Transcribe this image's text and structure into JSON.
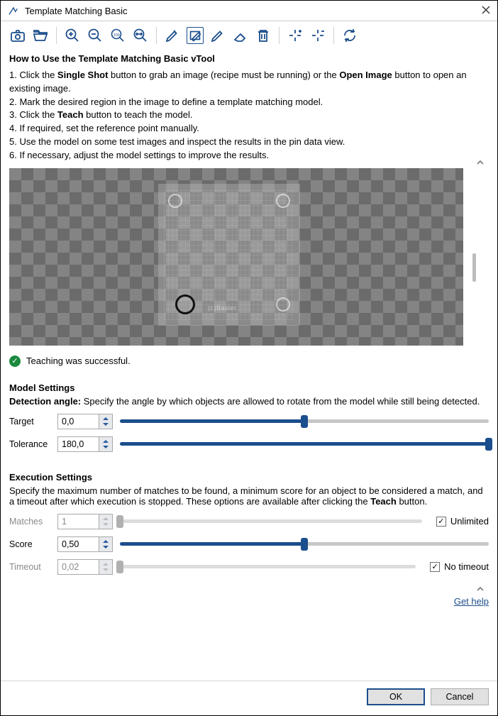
{
  "window": {
    "title": "Template Matching Basic"
  },
  "toolbar": {
    "icons": [
      "camera",
      "open",
      "zoom-in",
      "zoom-out",
      "zoom-100",
      "zoom-fit",
      "pencil-draw",
      "rect-select",
      "pencil-edit",
      "eraser",
      "delete",
      "crosshair-add",
      "crosshair-remove",
      "refresh"
    ]
  },
  "instructions": {
    "title": "How to Use the Template Matching Basic vTool",
    "line1_pre": "1. Click the ",
    "line1_bold1": "Single Shot",
    "line1_mid": " button to grab an image (recipe must be running) or the ",
    "line1_bold2": "Open Image",
    "line1_post": " button to open an existing image.",
    "line2": "2. Mark the desired region in the image to define a template matching model.",
    "line3_pre": "3. Click the ",
    "line3_bold": "Teach",
    "line3_post": " button to teach the model.",
    "line4": "4. If required, set the reference point manually.",
    "line5": "5. Use the model on some test images and inspect the results in the pin data view.",
    "line6": "6. If necessary, adjust the model settings to improve the results."
  },
  "preview": {
    "board_label": "(c)Basler"
  },
  "status": {
    "message": "Teaching was successful."
  },
  "model_settings": {
    "heading": "Model Settings",
    "subtitle_bold": "Detection angle:",
    "subtitle_rest": " Specify the angle by which objects are allowed to rotate from the model while still being detected.",
    "target_label": "Target",
    "target_value": "0,0",
    "target_percent": 50,
    "tolerance_label": "Tolerance",
    "tolerance_value": "180,0",
    "tolerance_percent": 100
  },
  "execution_settings": {
    "heading": "Execution Settings",
    "subtitle_pre": "Specify the maximum number of matches to be found, a minimum score for an object to be considered a match, and a timeout after which execution is stopped. These options are available after clicking the ",
    "subtitle_bold": "Teach",
    "subtitle_post": " button.",
    "matches_label": "Matches",
    "matches_value": "1",
    "matches_percent": 0,
    "unlimited_label": "Unlimited",
    "unlimited_checked": true,
    "score_label": "Score",
    "score_value": "0,50",
    "score_percent": 50,
    "timeout_label": "Timeout",
    "timeout_value": "0,02",
    "timeout_percent": 0,
    "no_timeout_label": "No timeout",
    "no_timeout_checked": true
  },
  "help": {
    "link": "Get help"
  },
  "footer": {
    "ok": "OK",
    "cancel": "Cancel"
  }
}
